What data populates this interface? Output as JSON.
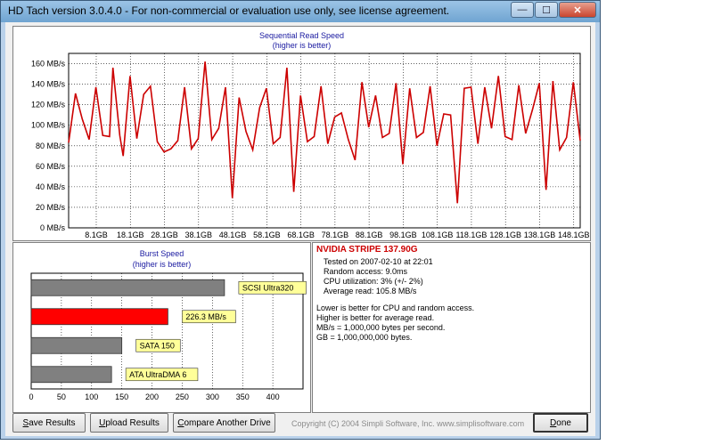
{
  "window": {
    "title": "HD Tach version 3.0.4.0  - For non-commercial or evaluation use only, see license agreement.",
    "minimize_glyph": "—",
    "maximize_glyph": "☐",
    "close_glyph": "✕"
  },
  "read_chart": {
    "title": "Sequential Read Speed",
    "subtitle": "(higher is better)"
  },
  "burst_chart": {
    "title": "Burst Speed",
    "subtitle": "(higher is better)"
  },
  "chart_data": [
    {
      "type": "line",
      "title": "Sequential Read Speed",
      "subtitle": "(higher is better)",
      "y_ticks": [
        "0 MB/s",
        "20 MB/s",
        "40 MB/s",
        "60 MB/s",
        "80 MB/s",
        "100 MB/s",
        "120 MB/s",
        "140 MB/s",
        "160 MB/s"
      ],
      "x_ticks": [
        "8.1GB",
        "18.1GB",
        "28.1GB",
        "38.1GB",
        "48.1GB",
        "58.1GB",
        "68.1GB",
        "78.1GB",
        "88.1GB",
        "98.1GB",
        "108.1GB",
        "118.1GB",
        "128.1GB",
        "138.1GB",
        "148.1GB"
      ],
      "ylim": [
        0,
        170
      ],
      "xlim": [
        0,
        150
      ],
      "grid": true,
      "line_color": "#cc0000",
      "series": [
        {
          "x": [
            0,
            2,
            4,
            6,
            8,
            10,
            12,
            13,
            15,
            16,
            18,
            20,
            22,
            24,
            26,
            28,
            30,
            32,
            34,
            36,
            38,
            40,
            42,
            44,
            46,
            48,
            50,
            52,
            54,
            56,
            58,
            60,
            62,
            64,
            66,
            68,
            70,
            72,
            74,
            76,
            78,
            80,
            82,
            84,
            86,
            88,
            90,
            92,
            94,
            96,
            98,
            100,
            102,
            104,
            106,
            108,
            110,
            112,
            114,
            116,
            118,
            120,
            122,
            124,
            126,
            128,
            130,
            132,
            134,
            136,
            138,
            140,
            142,
            144,
            146,
            148,
            150
          ],
          "y": [
            83,
            131,
            106,
            86,
            137,
            90,
            89,
            156,
            90,
            70,
            148,
            87,
            130,
            138,
            84,
            74,
            77,
            85,
            137,
            77,
            87,
            162,
            86,
            97,
            137,
            29,
            127,
            94,
            76,
            117,
            136,
            82,
            88,
            156,
            35,
            129,
            84,
            89,
            138,
            82,
            108,
            112,
            86,
            66,
            142,
            98,
            129,
            88,
            92,
            141,
            62,
            136,
            88,
            93,
            138,
            80,
            111,
            110,
            24,
            136,
            137,
            82,
            137,
            97,
            148,
            89,
            86,
            139,
            92,
            115,
            141,
            37,
            143,
            76,
            88,
            142,
            85
          ]
        }
      ]
    },
    {
      "type": "bar",
      "title": "Burst Speed",
      "subtitle": "(higher is better)",
      "x_ticks": [
        "0",
        "50",
        "100",
        "150",
        "200",
        "250",
        "300",
        "350",
        "400"
      ],
      "xlim": [
        0,
        450
      ],
      "categories": [
        "SCSI Ultra320",
        "NVIDIA STRIPE 137.90G",
        "SATA 150",
        "ATA UltraDMA 6"
      ],
      "values": [
        320,
        226.3,
        150,
        133
      ],
      "labels": [
        "SCSI Ultra320",
        "226.3 MB/s",
        "SATA 150",
        "ATA UltraDMA 6"
      ],
      "colors": [
        "#808080",
        "#ff0000",
        "#808080",
        "#808080"
      ]
    }
  ],
  "info": {
    "drive_name": "NVIDIA STRIPE 137.90G",
    "tested": "Tested on 2007-02-10 at 22:01",
    "random_access": "Random access: 9.0ms",
    "cpu": "CPU utilization: 3% (+/- 2%)",
    "average_read": "Average read: 105.8 MB/s",
    "note1": "Lower is better for CPU and random access.",
    "note2": "Higher is better for average read.",
    "note3": "MB/s = 1,000,000 bytes per second.",
    "note4": "GB = 1,000,000,000 bytes."
  },
  "buttons": {
    "save_prefix": "S",
    "save_rest": "ave Results",
    "upload_prefix": "U",
    "upload_rest": "pload Results",
    "compare_prefix": "C",
    "compare_rest": "ompare Another Drive",
    "done_prefix": "D",
    "done_rest": "one"
  },
  "copyright": "Copyright (C) 2004 Simpli Software, Inc. www.simplisoftware.com"
}
